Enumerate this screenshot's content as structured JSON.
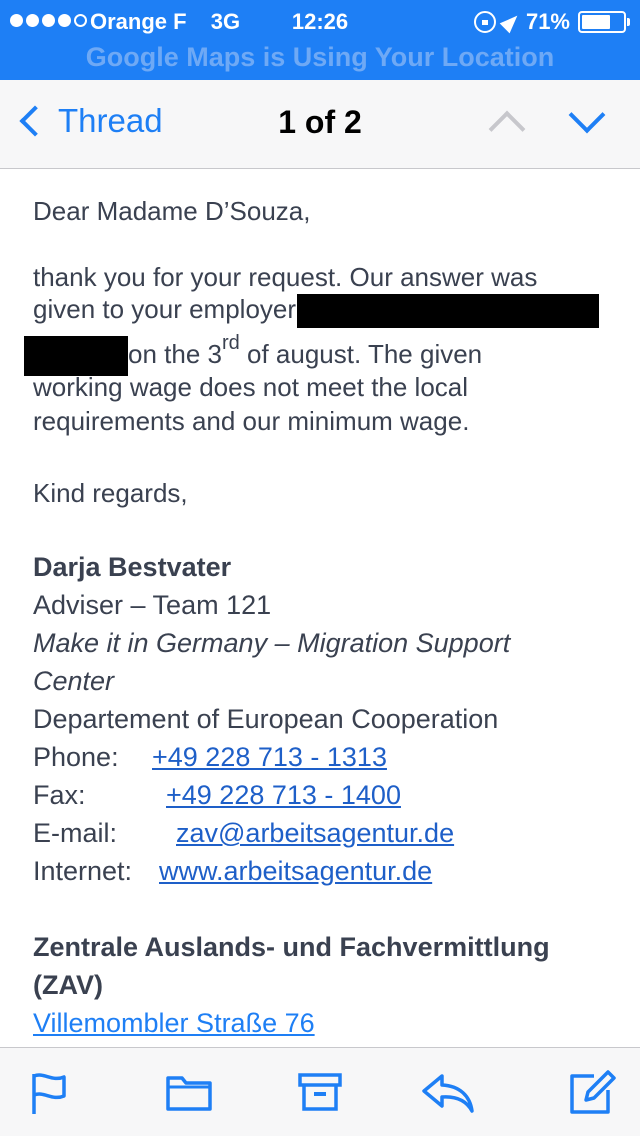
{
  "status_bar": {
    "carrier": "Orange F",
    "network": "3G",
    "time": "12:26",
    "battery": "71%",
    "battery_level": 0.71,
    "location_banner": "Google Maps is Using Your Location"
  },
  "nav": {
    "back_label": "Thread",
    "title": "1 of 2"
  },
  "email": {
    "greeting": "Dear Madame D’Souza,",
    "body_line1": "thank you for your request. Our answer was",
    "body_line2": "given to your employer",
    "body_line3_a": "on the 3",
    "body_line3_sup": "rd",
    "body_line3_b": " of august. The given",
    "body_line4": "working wage does not meet the local",
    "body_line5": "requirements and our minimum wage.",
    "closing": "Kind regards,",
    "signature": {
      "name": "Darja Bestvater",
      "role": "Adviser – Team 121",
      "org_line1": "Make it in Germany – Migration Support",
      "org_line2": "Center",
      "department": "Departement of European Cooperation",
      "phone_label": "Phone:",
      "phone": "+49 228 713 - 1313",
      "fax_label": "Fax:",
      "fax": "+49 228 713 - 1400",
      "email_label": "E-mail:",
      "email": "zav@arbeitsagentur.de",
      "internet_label": "Internet:",
      "internet": "www.arbeitsagentur.de",
      "agency_line1": "Zentrale Auslands- und Fachvermittlung",
      "agency_line2": "(ZAV)",
      "address": "Villemombler Straße 76"
    }
  },
  "toolbar": {
    "icons": [
      "flag-icon",
      "folder-icon",
      "archive-icon",
      "reply-icon",
      "compose-icon"
    ]
  },
  "colors": {
    "accent": "#1e7ff5",
    "link": "#1e5fc8",
    "text": "#3a4150"
  }
}
